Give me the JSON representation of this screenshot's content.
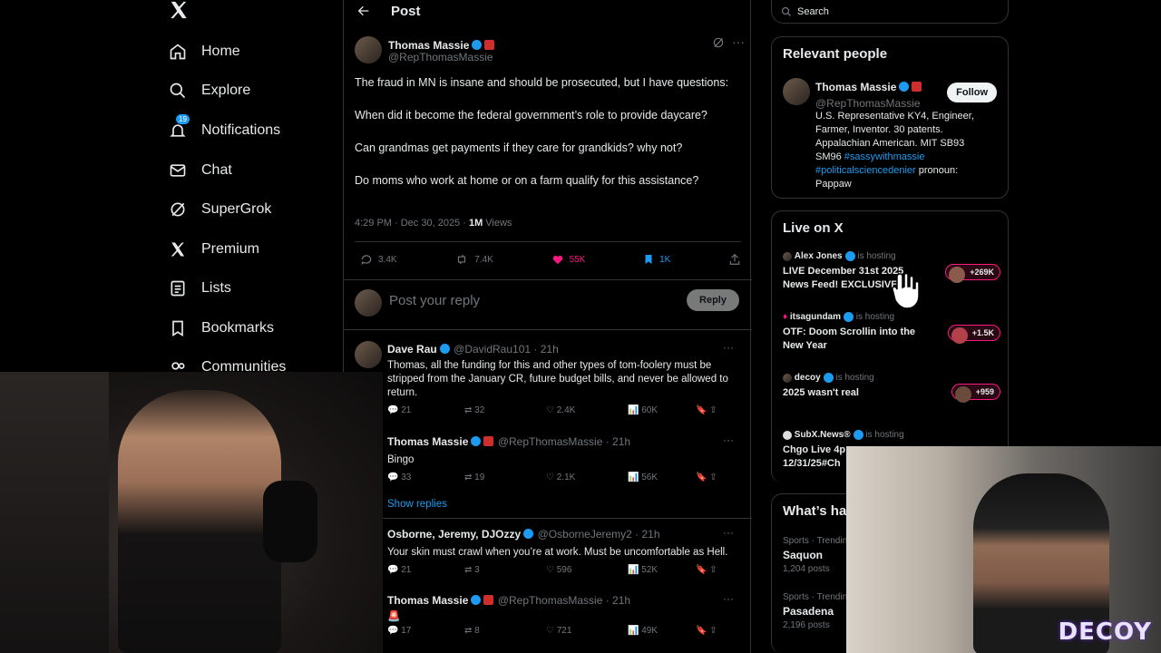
{
  "nav": {
    "items": [
      {
        "label": "Home",
        "icon": "home-icon"
      },
      {
        "label": "Explore",
        "icon": "search-icon"
      },
      {
        "label": "Notifications",
        "icon": "bell-icon",
        "badge": "19"
      },
      {
        "label": "Chat",
        "icon": "mail-icon"
      },
      {
        "label": "SuperGrok",
        "icon": "grok-icon"
      },
      {
        "label": "Premium",
        "icon": "x-logo-icon"
      },
      {
        "label": "Lists",
        "icon": "list-icon"
      },
      {
        "label": "Bookmarks",
        "icon": "bookmark-icon"
      },
      {
        "label": "Communities",
        "icon": "communities-icon"
      }
    ]
  },
  "header": {
    "title": "Post"
  },
  "post": {
    "author": "Thomas Massie",
    "handle": "@RepThomasMassie",
    "paragraphs": [
      "The fraud in MN is insane and should be prosecuted, but I have questions:",
      "When did it become the federal government’s role to provide daycare?",
      "Can grandmas get payments if they care for grandkids? why not?",
      "Do moms who work at home or on a farm qualify for this assistance?"
    ],
    "timestamp": "4:29 PM · Dec 30, 2025 · ",
    "views_count": "1M",
    "views_label": " Views",
    "stats": {
      "replies": "3.4K",
      "reposts": "7.4K",
      "likes": "55K",
      "bookmarks": "1K"
    }
  },
  "reply_box": {
    "placeholder": "Post your reply",
    "button": "Reply"
  },
  "replies": [
    {
      "author": "Dave Rau",
      "handle": "@DavidRau101 · 21h",
      "text": "Thomas, all the funding for this and other types of tom-foolery must be stripped from the January CR, future budget bills, and never be allowed to return.",
      "replies": "21",
      "reposts": "32",
      "likes": "2.4K",
      "views": "60K"
    },
    {
      "author": "Thomas Massie",
      "handle": "@RepThomasMassie · 21h",
      "text": "Bingo",
      "replies": "33",
      "reposts": "19",
      "likes": "2.1K",
      "views": "56K"
    },
    {
      "author": "Osborne, Jeremy, DJOzzy",
      "handle": "@OsborneJeremy2 · 21h",
      "text": "Your skin must crawl when you’re at work. Must be uncomfortable as Hell.",
      "replies": "21",
      "reposts": "3",
      "likes": "596",
      "views": "52K"
    },
    {
      "author": "Thomas Massie",
      "handle": "@RepThomasMassie · 21h",
      "text": "🚨",
      "replies": "17",
      "reposts": "8",
      "likes": "721",
      "views": "49K"
    }
  ],
  "show_replies": "Show replies",
  "search": {
    "placeholder": "Search"
  },
  "relevant": {
    "title": "Relevant people",
    "name": "Thomas Massie",
    "handle": "@RepThomasMassie",
    "follow": "Follow",
    "bio_text": "U.S. Representative KY4, Engineer, Farmer, Inventor. 30 patents. Appalachian American. MIT SB93 SM96 ",
    "bio_tag1": "#sassywithmassie",
    "bio_tag2": "#politicalsciencedenier",
    "bio_end": " pronoun: Pappaw"
  },
  "live": {
    "title": "Live on X",
    "hosting": "is hosting",
    "items": [
      {
        "host": "Alex Jones",
        "title": "LIVE December 31st 2025 News Feed! EXCLUSIVE",
        "count": "+269K"
      },
      {
        "host": "itsagundam",
        "title": "OTF: Doom Scrollin into the New Year",
        "count": "+1.5K"
      },
      {
        "host": "decoy",
        "title": "2025 wasn't real",
        "count": "+959"
      },
      {
        "host": "SubX.News®",
        "title": "Chgo Live 4p 12/31/25#Ch",
        "count": ""
      }
    ]
  },
  "trends": {
    "title": "What’s happening",
    "items": [
      {
        "category": "Sports · Trending",
        "name": "Saquon",
        "posts": "1,204 posts"
      },
      {
        "category": "Sports · Trending",
        "name": "Pasadena",
        "posts": "2,196 posts"
      }
    ]
  },
  "stream_logo": "DECOY",
  "colors": {
    "accent": "#1d9bf0",
    "like": "#f91880",
    "background": "#000000",
    "border": "#2f3336"
  }
}
